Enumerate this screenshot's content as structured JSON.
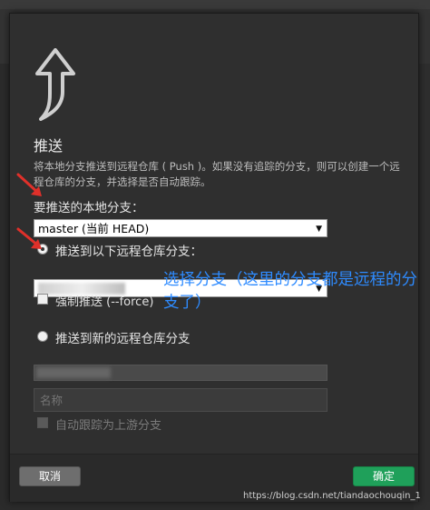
{
  "dialog": {
    "title": "推送",
    "description": "将本地分支推送到远程仓库 ( Push )。如果没有追踪的分支，则可以创建一个远程仓库的分支，并选择是否自动跟踪。",
    "local_branch_label": "要推送的本地分支：",
    "local_branch_value": "master (当前 HEAD)",
    "push_existing_label": "推送到以下远程仓库分支：",
    "force_push_label": "强制推送 (--force)",
    "push_new_label": "推送到新的远程仓库分支",
    "name_placeholder": "名称",
    "auto_track_label": "自动跟踪为上游分支",
    "cancel_label": "取消",
    "ok_label": "确定"
  },
  "annotation": {
    "note": "选择分支（这里的分支都是远程的分支了）"
  },
  "watermark": "https://blog.csdn.net/tiandaochouqin_1",
  "colors": {
    "accent_green": "#1fa05a",
    "annotation_blue": "#2e8bff",
    "annotation_red": "#e0302a"
  }
}
